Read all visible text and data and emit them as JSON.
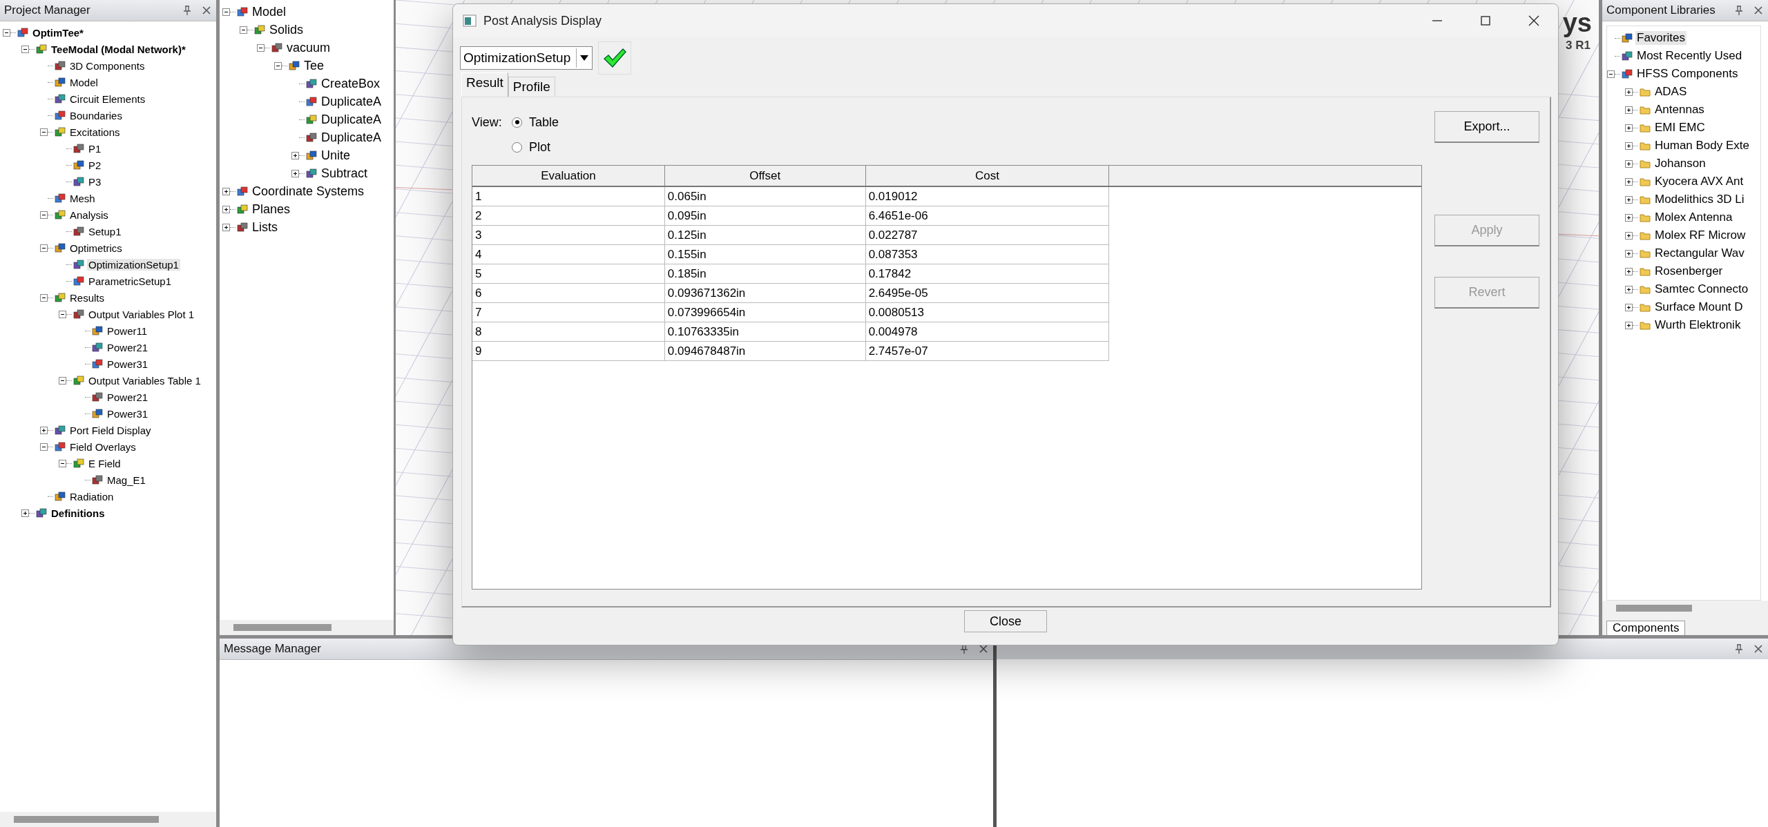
{
  "project_manager": {
    "title": "Project Manager",
    "tree": [
      {
        "label": "OptimTee*",
        "expanded": true,
        "selected": false,
        "children": [
          {
            "label": "TeeModal (Modal Network)*",
            "expanded": true,
            "selected": false,
            "children": [
              {
                "label": "3D Components",
                "selected": false
              },
              {
                "label": "Model",
                "selected": false
              },
              {
                "label": "Circuit Elements",
                "selected": false
              },
              {
                "label": "Boundaries",
                "selected": false
              },
              {
                "label": "Excitations",
                "expanded": true,
                "selected": false,
                "children": [
                  {
                    "label": "P1",
                    "selected": false
                  },
                  {
                    "label": "P2",
                    "selected": false
                  },
                  {
                    "label": "P3",
                    "selected": false
                  }
                ]
              },
              {
                "label": "Mesh",
                "selected": false
              },
              {
                "label": "Analysis",
                "expanded": true,
                "selected": false,
                "children": [
                  {
                    "label": "Setup1",
                    "selected": false
                  }
                ]
              },
              {
                "label": "Optimetrics",
                "expanded": true,
                "selected": false,
                "children": [
                  {
                    "label": "OptimizationSetup1",
                    "selected": true
                  },
                  {
                    "label": "ParametricSetup1",
                    "selected": false
                  }
                ]
              },
              {
                "label": "Results",
                "expanded": true,
                "selected": false,
                "children": [
                  {
                    "label": "Output Variables Plot 1",
                    "expanded": true,
                    "selected": false,
                    "children": [
                      {
                        "label": "Power11",
                        "selected": false
                      },
                      {
                        "label": "Power21",
                        "selected": false
                      },
                      {
                        "label": "Power31",
                        "selected": false
                      }
                    ]
                  },
                  {
                    "label": "Output Variables Table 1",
                    "expanded": true,
                    "selected": false,
                    "children": [
                      {
                        "label": "Power21",
                        "selected": false
                      },
                      {
                        "label": "Power31",
                        "selected": false
                      }
                    ]
                  }
                ]
              },
              {
                "label": "Port Field Display",
                "expanded": false,
                "selected": false
              },
              {
                "label": "Field Overlays",
                "expanded": true,
                "selected": false,
                "children": [
                  {
                    "label": "E Field",
                    "expanded": true,
                    "selected": false,
                    "children": [
                      {
                        "label": "Mag_E1",
                        "selected": false
                      }
                    ]
                  }
                ]
              },
              {
                "label": "Radiation",
                "selected": false
              }
            ]
          },
          {
            "label": "Definitions",
            "expanded": false,
            "selected": false
          }
        ]
      }
    ]
  },
  "model_tree": [
    {
      "label": "Model",
      "expanded": true,
      "selected": false,
      "children": [
        {
          "label": "Solids",
          "expanded": true,
          "selected": false,
          "children": [
            {
              "label": "vacuum",
              "expanded": true,
              "selected": false,
              "children": [
                {
                  "label": "Tee",
                  "expanded": true,
                  "selected": false,
                  "children": [
                    {
                      "label": "CreateBox",
                      "selected": false
                    },
                    {
                      "label": "DuplicateA",
                      "selected": false
                    },
                    {
                      "label": "DuplicateA",
                      "selected": false
                    },
                    {
                      "label": "DuplicateA",
                      "selected": false
                    },
                    {
                      "label": "Unite",
                      "expanded": false,
                      "selected": false
                    },
                    {
                      "label": "Subtract",
                      "expanded": false,
                      "selected": false
                    }
                  ]
                }
              ]
            }
          ]
        }
      ]
    },
    {
      "label": "Coordinate Systems",
      "expanded": false,
      "selected": false
    },
    {
      "label": "Planes",
      "expanded": false,
      "selected": false
    },
    {
      "label": "Lists",
      "expanded": false,
      "selected": false
    }
  ],
  "viewport": {
    "logo_text": "ys",
    "version_text": "3 R1"
  },
  "component_libraries": {
    "title": "Component Libraries",
    "tree": [
      {
        "label": "Favorites",
        "selected": true
      },
      {
        "label": "Most Recently Used",
        "selected": false
      },
      {
        "label": "HFSS Components",
        "expanded": true,
        "selected": false,
        "children": [
          {
            "label": "ADAS",
            "expanded": false,
            "selected": false
          },
          {
            "label": "Antennas",
            "expanded": false,
            "selected": false
          },
          {
            "label": "EMI EMC",
            "expanded": false,
            "selected": false
          },
          {
            "label": "Human Body Exte",
            "expanded": false,
            "selected": false
          },
          {
            "label": "Johanson",
            "expanded": false,
            "selected": false
          },
          {
            "label": "Kyocera AVX Ant",
            "expanded": false,
            "selected": false
          },
          {
            "label": "Modelithics 3D Li",
            "expanded": false,
            "selected": false
          },
          {
            "label": "Molex Antenna",
            "expanded": false,
            "selected": false
          },
          {
            "label": "Molex RF Microw",
            "expanded": false,
            "selected": false
          },
          {
            "label": "Rectangular Wav",
            "expanded": false,
            "selected": false
          },
          {
            "label": "Rosenberger",
            "expanded": false,
            "selected": false
          },
          {
            "label": "Samtec Connecto",
            "expanded": false,
            "selected": false
          },
          {
            "label": "Surface Mount D",
            "expanded": false,
            "selected": false
          },
          {
            "label": "Wurth Elektronik",
            "expanded": false,
            "selected": false
          }
        ]
      }
    ],
    "tab": "Components"
  },
  "message_manager": {
    "title": "Message Manager"
  },
  "dialog": {
    "title": "Post Analysis Display",
    "setup": "OptimizationSetup",
    "tabs": [
      {
        "label": "Result",
        "selected": true
      },
      {
        "label": "Profile",
        "selected": false
      }
    ],
    "view_label": "View:",
    "view_options": [
      {
        "label": "Table",
        "selected": true
      },
      {
        "label": "Plot",
        "selected": false
      }
    ],
    "table": {
      "columns": [
        "Evaluation",
        "Offset",
        "Cost"
      ],
      "rows": [
        [
          "1",
          "0.065in",
          "0.019012"
        ],
        [
          "2",
          "0.095in",
          "6.4651e-06"
        ],
        [
          "3",
          "0.125in",
          "0.022787"
        ],
        [
          "4",
          "0.155in",
          "0.087353"
        ],
        [
          "5",
          "0.185in",
          "0.17842"
        ],
        [
          "6",
          "0.093671362in",
          "2.6495e-05"
        ],
        [
          "7",
          "0.073996654in",
          "0.0080513"
        ],
        [
          "8",
          "0.10763335in",
          "0.004978"
        ],
        [
          "9",
          "0.094678487in",
          "2.7457e-07"
        ]
      ]
    },
    "buttons": [
      {
        "label": "Export...",
        "disabled": false
      },
      {
        "label": "Apply",
        "disabled": true
      },
      {
        "label": "Revert",
        "disabled": true
      }
    ],
    "close": "Close"
  }
}
